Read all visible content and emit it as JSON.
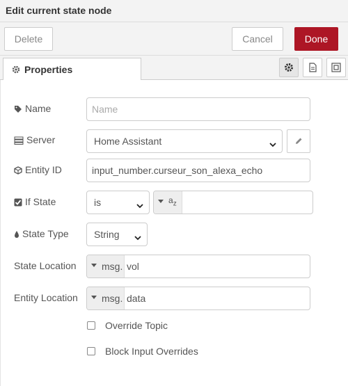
{
  "dialog": {
    "title": "Edit current state node"
  },
  "toolbar": {
    "delete_label": "Delete",
    "cancel_label": "Cancel",
    "done_label": "Done"
  },
  "tabs": {
    "properties_label": "Properties"
  },
  "form": {
    "name": {
      "label": "Name",
      "value": "",
      "placeholder": "Name"
    },
    "server": {
      "label": "Server",
      "value": "Home Assistant"
    },
    "entity_id": {
      "label": "Entity ID",
      "value": "input_number.curseur_son_alexa_echo"
    },
    "if_state": {
      "label": "If State",
      "operator": "is",
      "type_label": "a",
      "type_sub": "z",
      "value": ""
    },
    "state_type": {
      "label": "State Type",
      "value": "String"
    },
    "state_location": {
      "label": "State Location",
      "prefix": "msg.",
      "value": "vol"
    },
    "entity_location": {
      "label": "Entity Location",
      "prefix": "msg.",
      "value": "data"
    },
    "override_topic": {
      "label": "Override Topic",
      "checked": false
    },
    "block_input_overrides": {
      "label": "Block Input Overrides",
      "checked": false
    }
  },
  "icons": {
    "properties_tab": "gear-icon",
    "tab_buttons": [
      "gear-icon",
      "document-icon",
      "frame-icon"
    ],
    "name": "tag-icon",
    "server": "server-icon",
    "entity_id": "cube-icon",
    "if_state": "check-square-icon",
    "state_type": "tint-icon",
    "server_edit": "pencil-icon"
  },
  "colors": {
    "accent": "#ad1625",
    "panel_bg": "#f3f3f3",
    "border": "#cccccc"
  }
}
